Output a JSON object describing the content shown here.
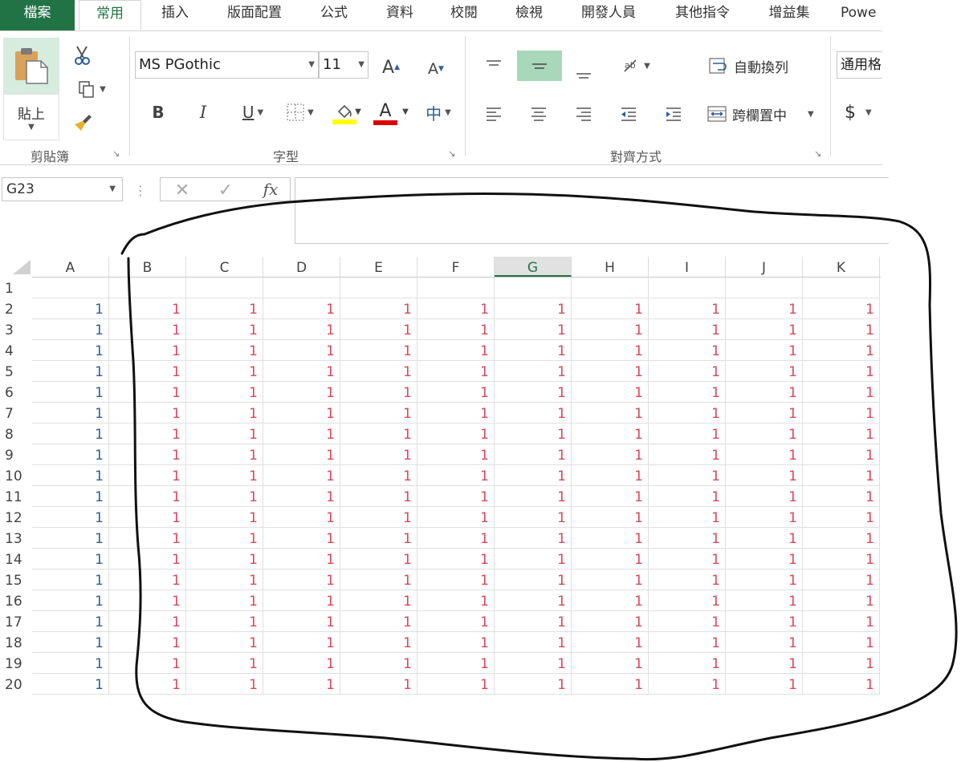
{
  "tabs": [
    "檔案",
    "常用",
    "插入",
    "版面配置",
    "公式",
    "資料",
    "校閱",
    "檢視",
    "開發人員",
    "其他指令",
    "增益集",
    "Powe"
  ],
  "active_tab": "常用",
  "ribbon": {
    "clipboard": {
      "paste_label": "貼上",
      "group_label": "剪貼簿"
    },
    "font": {
      "font_name": "MS PGothic",
      "font_size": "11",
      "bold": "B",
      "italic": "I",
      "underline": "U",
      "font_color_glyph": "A",
      "phonetic_glyph": "中",
      "grow_glyph": "A",
      "shrink_glyph": "A",
      "group_label": "字型"
    },
    "alignment": {
      "wrap_text_label": "自動換列",
      "merge_center_label": "跨欄置中",
      "group_label": "對齊方式"
    },
    "number": {
      "format_label": "通用格",
      "currency_glyph": "$"
    },
    "colors": {
      "accent": "#217346",
      "fill_color": "#ffff00",
      "font_color": "#e00000"
    }
  },
  "formula_bar": {
    "name_box": "G23",
    "fx_label": "fx",
    "formula": ""
  },
  "sheet": {
    "columns": [
      "A",
      "B",
      "C",
      "D",
      "E",
      "F",
      "G",
      "H",
      "I",
      "J",
      "K"
    ],
    "selected_column": "G",
    "rows": [
      {
        "num": "1",
        "values": [
          "",
          "",
          "",
          "",
          "",
          "",
          "",
          "",
          "",
          "",
          ""
        ]
      },
      {
        "num": "2",
        "values": [
          "1",
          "1",
          "1",
          "1",
          "1",
          "1",
          "1",
          "1",
          "1",
          "1",
          "1"
        ]
      },
      {
        "num": "3",
        "values": [
          "1",
          "1",
          "1",
          "1",
          "1",
          "1",
          "1",
          "1",
          "1",
          "1",
          "1"
        ]
      },
      {
        "num": "4",
        "values": [
          "1",
          "1",
          "1",
          "1",
          "1",
          "1",
          "1",
          "1",
          "1",
          "1",
          "1"
        ]
      },
      {
        "num": "5",
        "values": [
          "1",
          "1",
          "1",
          "1",
          "1",
          "1",
          "1",
          "1",
          "1",
          "1",
          "1"
        ]
      },
      {
        "num": "6",
        "values": [
          "1",
          "1",
          "1",
          "1",
          "1",
          "1",
          "1",
          "1",
          "1",
          "1",
          "1"
        ]
      },
      {
        "num": "7",
        "values": [
          "1",
          "1",
          "1",
          "1",
          "1",
          "1",
          "1",
          "1",
          "1",
          "1",
          "1"
        ]
      },
      {
        "num": "8",
        "values": [
          "1",
          "1",
          "1",
          "1",
          "1",
          "1",
          "1",
          "1",
          "1",
          "1",
          "1"
        ]
      },
      {
        "num": "9",
        "values": [
          "1",
          "1",
          "1",
          "1",
          "1",
          "1",
          "1",
          "1",
          "1",
          "1",
          "1"
        ]
      },
      {
        "num": "10",
        "values": [
          "1",
          "1",
          "1",
          "1",
          "1",
          "1",
          "1",
          "1",
          "1",
          "1",
          "1"
        ]
      },
      {
        "num": "11",
        "values": [
          "1",
          "1",
          "1",
          "1",
          "1",
          "1",
          "1",
          "1",
          "1",
          "1",
          "1"
        ]
      },
      {
        "num": "12",
        "values": [
          "1",
          "1",
          "1",
          "1",
          "1",
          "1",
          "1",
          "1",
          "1",
          "1",
          "1"
        ]
      },
      {
        "num": "13",
        "values": [
          "1",
          "1",
          "1",
          "1",
          "1",
          "1",
          "1",
          "1",
          "1",
          "1",
          "1"
        ]
      },
      {
        "num": "14",
        "values": [
          "1",
          "1",
          "1",
          "1",
          "1",
          "1",
          "1",
          "1",
          "1",
          "1",
          "1"
        ]
      },
      {
        "num": "15",
        "values": [
          "1",
          "1",
          "1",
          "1",
          "1",
          "1",
          "1",
          "1",
          "1",
          "1",
          "1"
        ]
      },
      {
        "num": "16",
        "values": [
          "1",
          "1",
          "1",
          "1",
          "1",
          "1",
          "1",
          "1",
          "1",
          "1",
          "1"
        ]
      },
      {
        "num": "17",
        "values": [
          "1",
          "1",
          "1",
          "1",
          "1",
          "1",
          "1",
          "1",
          "1",
          "1",
          "1"
        ]
      },
      {
        "num": "18",
        "values": [
          "1",
          "1",
          "1",
          "1",
          "1",
          "1",
          "1",
          "1",
          "1",
          "1",
          "1"
        ]
      },
      {
        "num": "19",
        "values": [
          "1",
          "1",
          "1",
          "1",
          "1",
          "1",
          "1",
          "1",
          "1",
          "1",
          "1"
        ]
      },
      {
        "num": "20",
        "values": [
          "1",
          "1",
          "1",
          "1",
          "1",
          "1",
          "1",
          "1",
          "1",
          "1",
          "1"
        ]
      }
    ],
    "column_a_color": "#2b5f9e",
    "other_columns_color": "#d9485c"
  }
}
